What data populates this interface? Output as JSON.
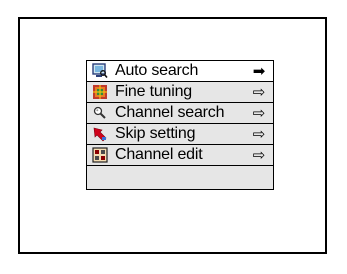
{
  "menu": {
    "items": [
      {
        "label": "Auto search",
        "icon": "monitor-search-icon",
        "arrow": "➡",
        "selected": true
      },
      {
        "label": "Fine tuning",
        "icon": "fine-tuning-icon",
        "arrow": "⇨",
        "selected": false
      },
      {
        "label": "Channel search",
        "icon": "magnifier-icon",
        "arrow": "⇨",
        "selected": false
      },
      {
        "label": "Skip setting",
        "icon": "skip-red-arrow-icon",
        "arrow": "⇨",
        "selected": false
      },
      {
        "label": "Channel edit",
        "icon": "channel-edit-icon",
        "arrow": "⇨",
        "selected": false
      }
    ]
  },
  "colors": {
    "menu_bg": "#e6e6e6",
    "selected_bg": "#ffffff",
    "border": "#000000"
  }
}
